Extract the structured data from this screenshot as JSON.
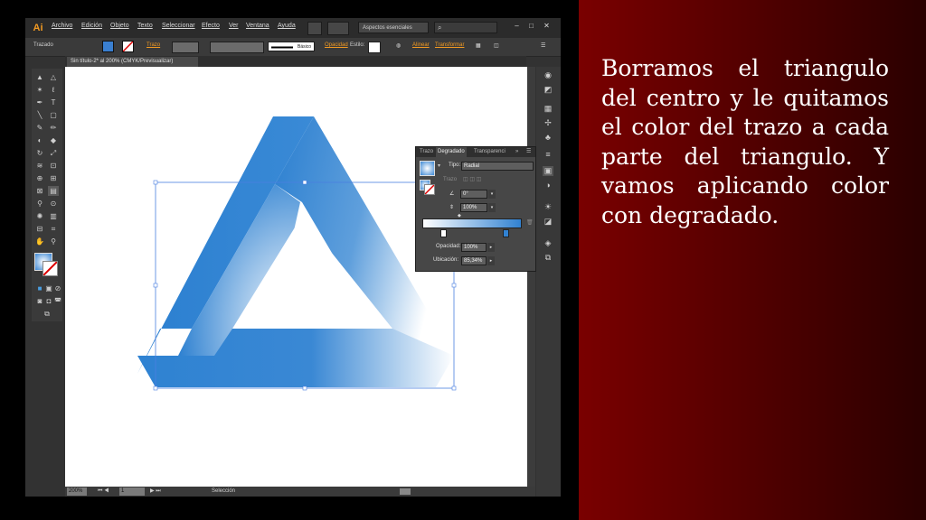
{
  "app": {
    "logo": "Ai",
    "menu": [
      "Archivo",
      "Edición",
      "Objeto",
      "Texto",
      "Seleccionar",
      "Efecto",
      "Ver",
      "Ventana",
      "Ayuda"
    ],
    "workspace": "Aspectos esenciales",
    "search_icon": "search-icon",
    "window_controls": [
      "–",
      "□",
      "✕"
    ]
  },
  "control_bar": {
    "selection_label": "Trazado",
    "stroke_label": "Trazo",
    "brush_label": "Básico",
    "opacity_label": "Opacidad",
    "style_label": "Estilo:",
    "align_label": "Alinear",
    "transform_label": "Transformar"
  },
  "document": {
    "tab_title": "Sin título-2* al 200% (CMYK/Previsualizar)"
  },
  "statusbar": {
    "zoom": "200%",
    "page": "1",
    "status": "Selección"
  },
  "gradient_panel": {
    "tabs": [
      "Trazo",
      "Degradado",
      "Transparenci"
    ],
    "tipo_label": "Tipo:",
    "tipo_value": "Radial",
    "trazo_label": "Trazo",
    "angle_value": "0°",
    "aspect_value": "100%",
    "opacity_label": "Opacidad:",
    "opacity_value": "100%",
    "location_label": "Ubicación:",
    "location_value": "85,34%"
  },
  "slide": {
    "text": "Borramos el triangulo del centro y le quitamos el color del trazo a cada parte del triangulo. Y vamos aplicando color con degradado."
  },
  "colors": {
    "accent_orange": "#f29a22",
    "triangle_blue": "#2b7fd0",
    "slide_red": "#7a0000"
  }
}
